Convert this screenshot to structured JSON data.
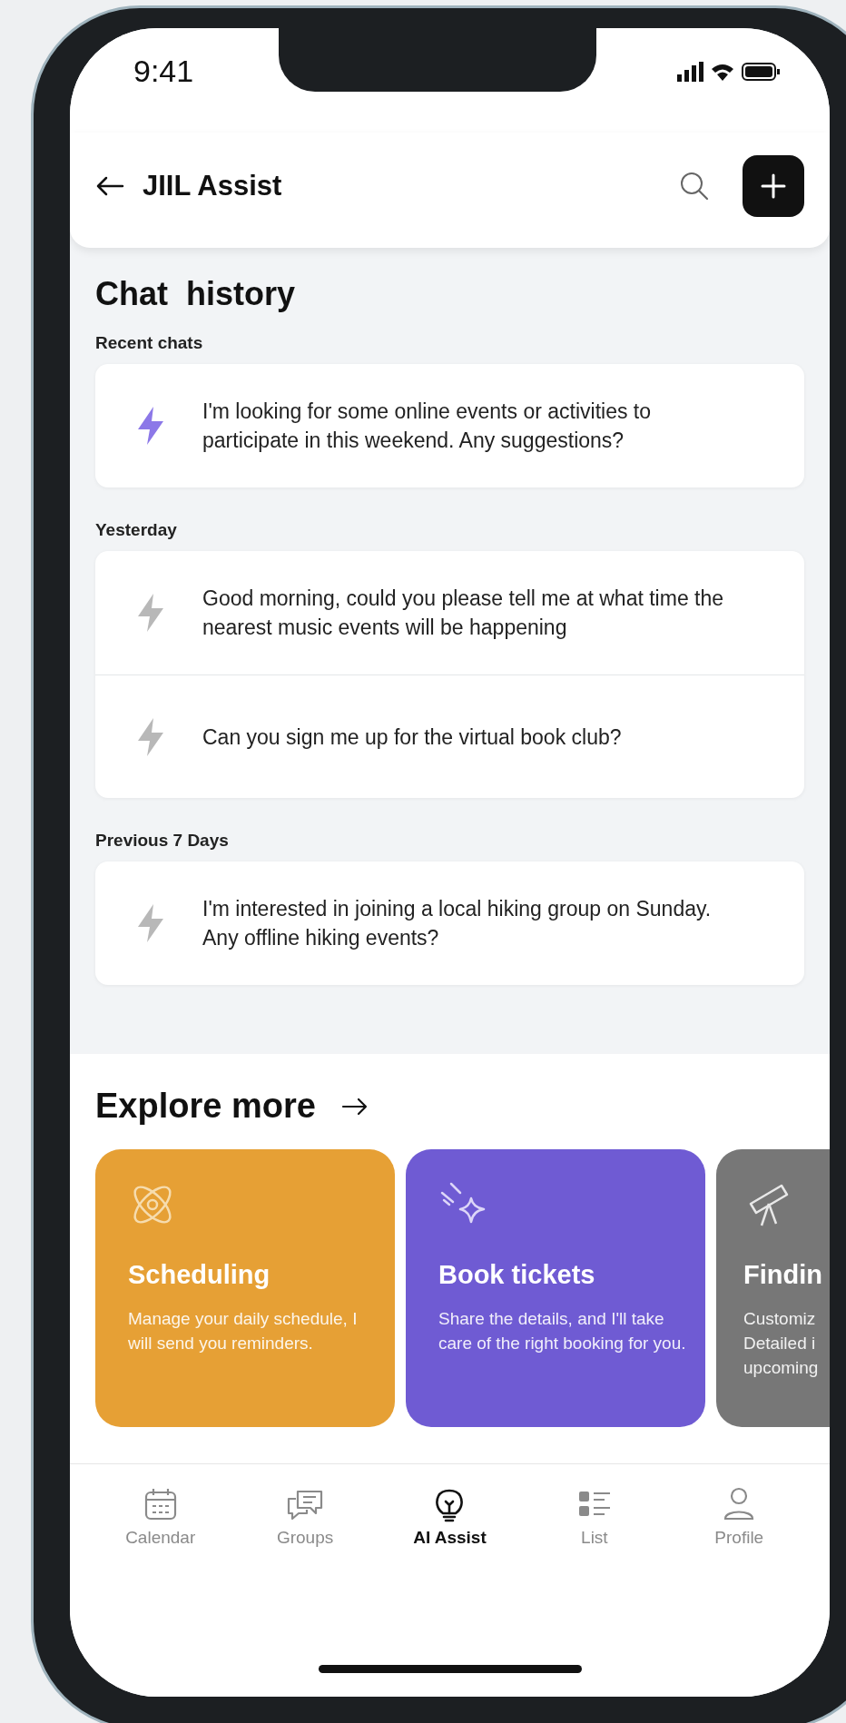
{
  "status_bar": {
    "time": "9:41"
  },
  "header": {
    "title": "JIIL Assist"
  },
  "chat_history": {
    "title": "Chat  history",
    "sections": [
      {
        "label": "Recent chats",
        "chats": [
          {
            "text": "I'm looking for some online events or activities to participate in this weekend. Any suggestions?",
            "highlighted": true
          }
        ]
      },
      {
        "label": "Yesterday",
        "chats": [
          {
            "text": "Good morning, could you please tell me at what time the nearest music events will be happening",
            "highlighted": false
          },
          {
            "text": "Can you sign me up for the virtual book club?",
            "highlighted": false
          }
        ]
      },
      {
        "label": "Previous 7 Days",
        "chats": [
          {
            "text": "I'm interested in joining a local hiking group on Sunday. Any offline hiking events?",
            "highlighted": false
          }
        ]
      }
    ]
  },
  "explore": {
    "title": "Explore more",
    "cards": [
      {
        "kind": "atom",
        "title": "Scheduling",
        "text": "Manage your daily schedule, I will send you reminders.",
        "color": "#e6a035"
      },
      {
        "kind": "sparkle",
        "title": "Book tickets",
        "text": "Share the details, and I'll take care of the right booking for you.",
        "color": "#6f5bd3"
      },
      {
        "kind": "telescope",
        "title": "Findin",
        "text": "Customiz Detailed i upcoming",
        "color": "#777777"
      }
    ]
  },
  "tab_bar": [
    {
      "kind": "calendar",
      "label": "Calendar",
      "selected": false
    },
    {
      "kind": "groups",
      "label": "Groups",
      "selected": false
    },
    {
      "kind": "bulb",
      "label": "AI Assist",
      "selected": true
    },
    {
      "kind": "list",
      "label": "List",
      "selected": false
    },
    {
      "kind": "profile",
      "label": "Profile",
      "selected": false
    }
  ]
}
